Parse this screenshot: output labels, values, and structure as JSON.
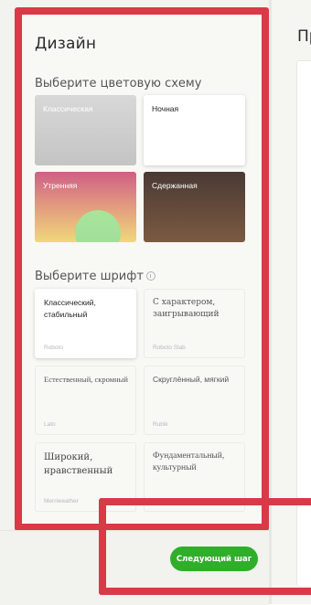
{
  "design": {
    "title": "Дизайн",
    "color_section_label": "Выберите цветовую схему",
    "font_section_label": "Выберите шрифт"
  },
  "color_schemes": [
    {
      "name": "Классическая",
      "colors": [
        "#d8d8d8",
        "#c4c4c4"
      ]
    },
    {
      "name": "Ночная",
      "colors": [
        "#ffffff"
      ],
      "selected": true
    },
    {
      "name": "Утренняя",
      "colors": [
        "#cf5f85",
        "#e19680",
        "#f0d87a",
        "#a8e59b"
      ]
    },
    {
      "name": "Сдержанная",
      "colors": [
        "#4a3a34",
        "#7c5a42"
      ]
    }
  ],
  "fonts": [
    {
      "description": "Классический, стабильный",
      "font_name": "Roboto",
      "selected": true
    },
    {
      "description": "С характером, заигрывающий",
      "font_name": "Roboto Slab"
    },
    {
      "description": "Естественный, скромный",
      "font_name": "Lato"
    },
    {
      "description": "Скруглённый, мягкий",
      "font_name": "Rubik"
    },
    {
      "description": "Широкий, нравственный",
      "font_name": "Merriweather"
    },
    {
      "description": "Фундаментальный, культурный",
      "font_name": "Vollkorn"
    }
  ],
  "preview": {
    "title": "Пр"
  },
  "footer": {
    "next_label": "Следующий шаг"
  },
  "colors": {
    "accent_green": "#2fae2a",
    "highlight_red": "#d93a47"
  },
  "icons": {
    "font_info": "info-icon"
  }
}
